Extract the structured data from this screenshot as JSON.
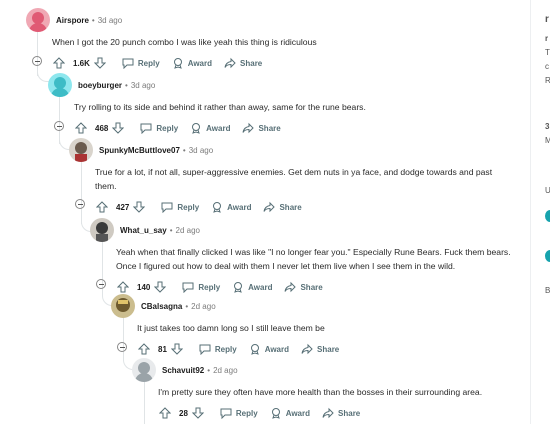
{
  "colors": {
    "accent": "#ff4500",
    "meta_text": "#7c7c7c",
    "action_text": "#576f76",
    "thread_line": "#e0e4e6"
  },
  "labels": {
    "reply": "Reply",
    "award": "Award",
    "share": "Share",
    "separator": "•"
  },
  "comments": [
    {
      "user": "Airspore",
      "time": "3d ago",
      "text": "When I got the 20 punch combo I was like yeah this thing is ridiculous",
      "votes": "1.6K"
    },
    {
      "user": "boeyburger",
      "time": "3d ago",
      "text": "Try rolling to its side and behind it rather than away, same for the rune bears.",
      "votes": "468"
    },
    {
      "user": "SpunkyMcButtlove07",
      "time": "3d ago",
      "text": "True for a lot, if not all, super-aggressive enemies. Get dem nuts in ya face, and dodge towards and past them.",
      "votes": "427"
    },
    {
      "user": "What_u_say",
      "time": "2d ago",
      "text": "Yeah when that finally clicked I was like \"I no longer fear you.\" Especially Rune Bears. Fuck them bears. Once I figured out how to deal with them I never let them live when I see them in the wild.",
      "votes": "140"
    },
    {
      "user": "CBalsagna",
      "time": "2d ago",
      "text": "It just takes too damn long so I still leave them be",
      "votes": "81"
    },
    {
      "user": "Schavuit92",
      "time": "2d ago",
      "text": "I'm pretty sure they often have more health than the bosses in their surrounding area.",
      "votes": "28"
    }
  ],
  "sidebar": {
    "fragments": [
      "r",
      "r",
      "T",
      "c",
      "R",
      "3",
      "M",
      "U",
      "B"
    ]
  }
}
